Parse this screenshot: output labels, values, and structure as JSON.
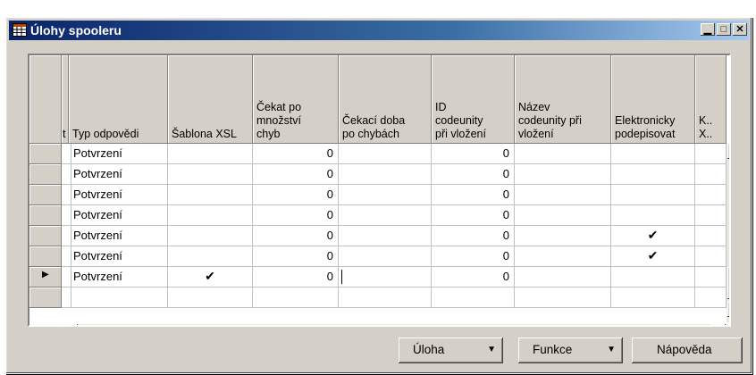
{
  "window": {
    "title": "Úlohy spooleru"
  },
  "columns": [
    {
      "key": "t",
      "label": "t"
    },
    {
      "key": "typ",
      "label": "Typ odpovědi"
    },
    {
      "key": "xsl",
      "label": "Šablona XSL"
    },
    {
      "key": "cekat",
      "label": "Čekat po\nmnožství\nchyb"
    },
    {
      "key": "doba",
      "label": "Čekací doba\npo chybách"
    },
    {
      "key": "id",
      "label": "ID\ncodeunity\npři vložení"
    },
    {
      "key": "nazev",
      "label": "Název\ncodeunity při\nvložení"
    },
    {
      "key": "el",
      "label": "Elektronicky\npodepisovat"
    },
    {
      "key": "k",
      "label": "K..\nX.."
    }
  ],
  "rows": [
    {
      "typ": "Potvrzení",
      "xsl": false,
      "cekat": "0",
      "id": "0",
      "el": false,
      "current": false
    },
    {
      "typ": "Potvrzení",
      "xsl": false,
      "cekat": "0",
      "id": "0",
      "el": false,
      "current": false
    },
    {
      "typ": "Potvrzení",
      "xsl": false,
      "cekat": "0",
      "id": "0",
      "el": false,
      "current": false
    },
    {
      "typ": "Potvrzení",
      "xsl": false,
      "cekat": "0",
      "id": "0",
      "el": false,
      "current": false
    },
    {
      "typ": "Potvrzení",
      "xsl": false,
      "cekat": "0",
      "id": "0",
      "el": true,
      "current": false
    },
    {
      "typ": "Potvrzení",
      "xsl": false,
      "cekat": "0",
      "id": "0",
      "el": true,
      "current": false
    },
    {
      "typ": "Potvrzení",
      "xsl": true,
      "cekat": "0",
      "id": "0",
      "el": false,
      "current": true
    }
  ],
  "buttons": {
    "uloha": "Úloha",
    "funkce": "Funkce",
    "napoveda": "Nápověda"
  },
  "icons": {
    "check": "✔",
    "current_row": "▶",
    "up": "▲",
    "down": "▼",
    "left": "◀",
    "right": "▶"
  }
}
